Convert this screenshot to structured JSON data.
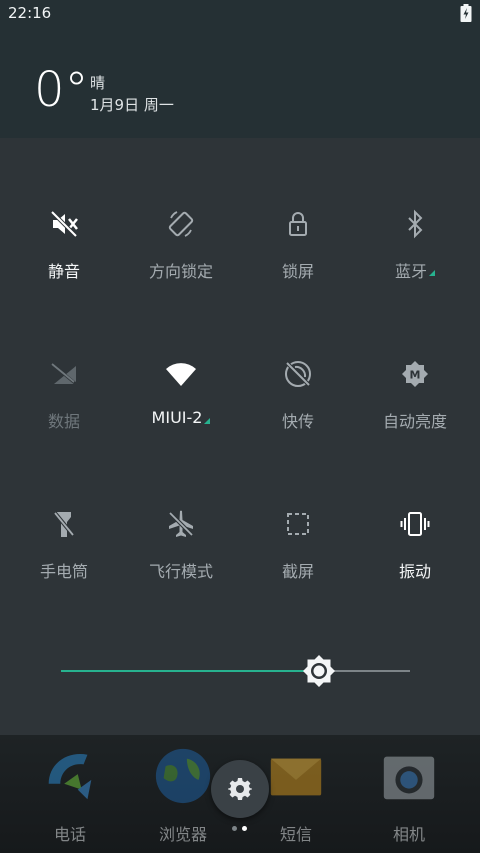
{
  "status_bar": {
    "time": "22:16",
    "battery_icon": "battery-charging-icon"
  },
  "header": {
    "temperature": "0°",
    "weather": "晴",
    "date": "1月9日 周一"
  },
  "toggles": [
    {
      "label": "静音",
      "icon": "mute-icon",
      "state": "on"
    },
    {
      "label": "方向锁定",
      "icon": "rotation-lock-icon",
      "state": "off"
    },
    {
      "label": "锁屏",
      "icon": "lock-icon",
      "state": "off"
    },
    {
      "label": "蓝牙",
      "icon": "bluetooth-icon",
      "state": "off"
    },
    {
      "label": "数据",
      "icon": "mobile-data-icon",
      "state": "dim"
    },
    {
      "label": "MIUI-2",
      "icon": "wifi-icon",
      "state": "on"
    },
    {
      "label": "快传",
      "icon": "quick-transfer-icon",
      "state": "off"
    },
    {
      "label": "自动亮度",
      "icon": "auto-brightness-icon",
      "state": "off"
    },
    {
      "label": "手电筒",
      "icon": "flashlight-icon",
      "state": "off"
    },
    {
      "label": "飞行模式",
      "icon": "airplane-icon",
      "state": "off"
    },
    {
      "label": "截屏",
      "icon": "screenshot-icon",
      "state": "off"
    },
    {
      "label": "振动",
      "icon": "vibrate-icon",
      "state": "on"
    }
  ],
  "brightness": {
    "level": 0.74,
    "icon": "brightness-icon"
  },
  "dock": {
    "apps": [
      {
        "label": "电话",
        "icon": "phone-app-icon"
      },
      {
        "label": "浏览器",
        "icon": "browser-app-icon"
      },
      {
        "label": "短信",
        "icon": "messages-app-icon"
      },
      {
        "label": "相机",
        "icon": "camera-app-icon"
      }
    ],
    "settings_icon": "gear-icon",
    "page_count": 2,
    "current_page": 2
  },
  "colors": {
    "accent": "#27b28f",
    "panel": "#2e3438",
    "header": "#253034"
  }
}
